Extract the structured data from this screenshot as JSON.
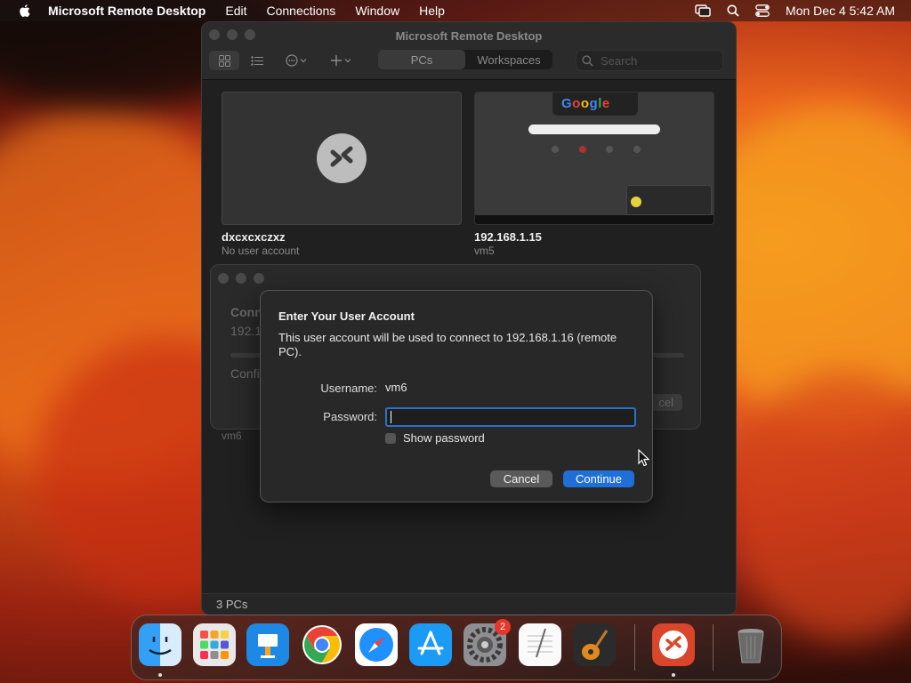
{
  "menubar": {
    "app_name": "Microsoft Remote Desktop",
    "menus": [
      "Edit",
      "Connections",
      "Window",
      "Help"
    ],
    "clock": "Mon Dec 4  5:42 AM",
    "icons": [
      "apple-icon",
      "screen-mirroring-icon",
      "search-icon",
      "control-center-icon"
    ]
  },
  "window": {
    "title": "Microsoft Remote Desktop",
    "segments": [
      "PCs",
      "Workspaces"
    ],
    "search_placeholder": "Search",
    "pcs": [
      {
        "name": "dxcxcxczxz",
        "subtitle": "No user account"
      },
      {
        "name": "192.168.1.15",
        "subtitle": "vm5"
      }
    ],
    "hidden_pc_subtitle": "vm6",
    "status": "3 PCs"
  },
  "conn_window": {
    "heading_fragment": "Conn",
    "ip_fragment": "192.1",
    "confirm_fragment": "Confi",
    "cancel_fragment": "cel"
  },
  "dialog": {
    "title": "Enter Your User Account",
    "message": "This user account will be used to connect to 192.168.1.16 (remote PC).",
    "username_label": "Username:",
    "username_value": "vm6",
    "password_label": "Password:",
    "password_value": "",
    "show_password_label": "Show password",
    "show_password_checked": false,
    "cancel_label": "Cancel",
    "continue_label": "Continue",
    "accent_color": "#1f6fd6"
  },
  "dock": {
    "apps": [
      "Finder",
      "Launchpad",
      "Keynote",
      "Google Chrome",
      "Safari",
      "App Store",
      "System Settings",
      "TextEdit",
      "GarageBand",
      "Microsoft Remote Desktop",
      "Trash"
    ],
    "system_settings_badge": "2"
  }
}
